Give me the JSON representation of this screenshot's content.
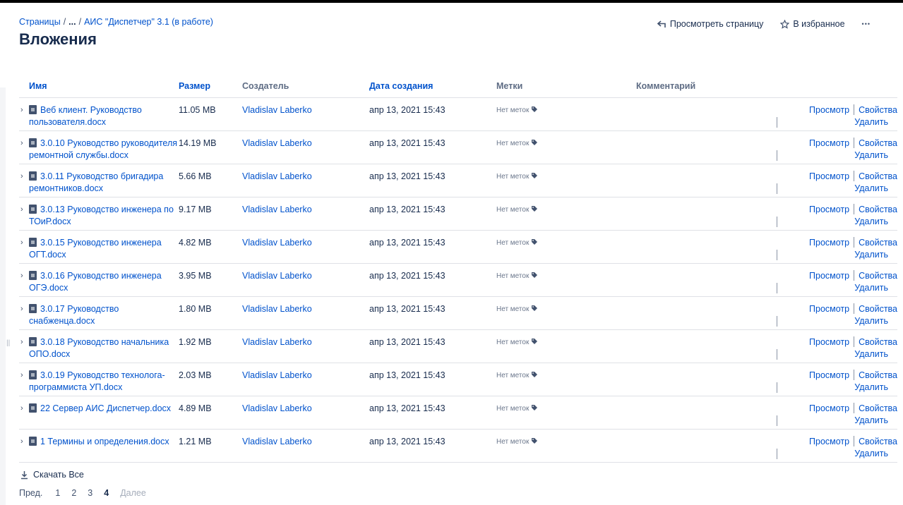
{
  "breadcrumb": {
    "root": "Страницы",
    "ellipsis": "...",
    "parent": "АИС \"Диспетчер\" 3.1 (в работе)"
  },
  "page_title": "Вложения",
  "header_actions": {
    "view_page": "Просмотреть страницу",
    "favorite": "В избранное",
    "more": "•••"
  },
  "table": {
    "columns": {
      "name": "Имя",
      "size": "Размер",
      "creator": "Создатель",
      "date": "Дата создания",
      "labels": "Метки",
      "comment": "Комментарий"
    },
    "no_labels": "Нет меток",
    "action_view": "Просмотр",
    "action_props": "Свойства",
    "action_delete": "Удалить",
    "rows": [
      {
        "name": "Веб клиент. Руководство пользователя.docx",
        "size": "11.05 MB",
        "creator": "Vladislav Laberko",
        "date": "апр 13, 2021 15:43"
      },
      {
        "name": "3.0.10 Руководство руководителя ремонтной службы.docx",
        "size": "14.19 MB",
        "creator": "Vladislav Laberko",
        "date": "апр 13, 2021 15:43"
      },
      {
        "name": "3.0.11 Руководство бригадира ремонтников.docx",
        "size": "5.66 MB",
        "creator": "Vladislav Laberko",
        "date": "апр 13, 2021 15:43"
      },
      {
        "name": "3.0.13 Руководство инженера по ТОиР.docx",
        "size": "9.17 MB",
        "creator": "Vladislav Laberko",
        "date": "апр 13, 2021 15:43"
      },
      {
        "name": "3.0.15 Руководство инженера ОГТ.docx",
        "size": "4.82 MB",
        "creator": "Vladislav Laberko",
        "date": "апр 13, 2021 15:43"
      },
      {
        "name": "3.0.16 Руководство инженера ОГЭ.docx",
        "size": "3.95 MB",
        "creator": "Vladislav Laberko",
        "date": "апр 13, 2021 15:43"
      },
      {
        "name": "3.0.17 Руководство снабженца.docx",
        "size": "1.80 MB",
        "creator": "Vladislav Laberko",
        "date": "апр 13, 2021 15:43"
      },
      {
        "name": "3.0.18 Руководство начальника ОПО.docx",
        "size": "1.92 MB",
        "creator": "Vladislav Laberko",
        "date": "апр 13, 2021 15:43"
      },
      {
        "name": "3.0.19 Руководство технолога-программиста УП.docx",
        "size": "2.03 MB",
        "creator": "Vladislav Laberko",
        "date": "апр 13, 2021 15:43"
      },
      {
        "name": "22 Сервер АИС Диспетчер.docx",
        "size": "4.89 MB",
        "creator": "Vladislav Laberko",
        "date": "апр 13, 2021 15:43"
      },
      {
        "name": "1 Термины и определения.docx",
        "size": "1.21 MB",
        "creator": "Vladislav Laberko",
        "date": "апр 13, 2021 15:43"
      }
    ]
  },
  "download_all": "Скачать Все",
  "pagination": {
    "prev": "Пред.",
    "pages": [
      "1",
      "2",
      "3",
      "4"
    ],
    "current": "4",
    "next": "Далее"
  },
  "colors": {
    "link": "#0052cc",
    "text": "#172b4d",
    "muted": "#5e6c84",
    "border": "#dfe1e6"
  }
}
